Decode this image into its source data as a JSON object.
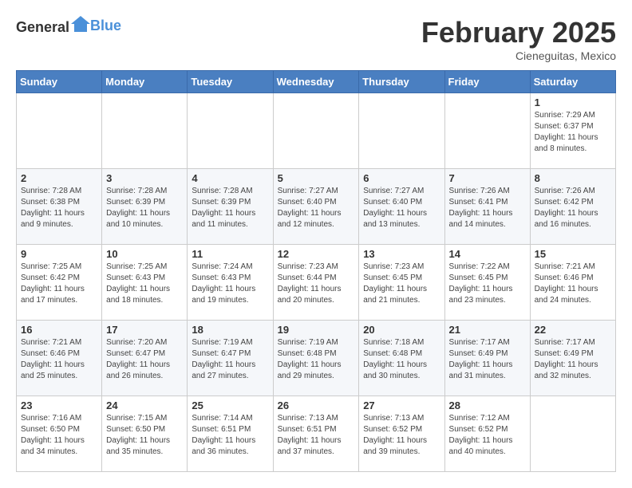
{
  "header": {
    "logo_general": "General",
    "logo_blue": "Blue",
    "title": "February 2025",
    "subtitle": "Cieneguitas, Mexico"
  },
  "days_of_week": [
    "Sunday",
    "Monday",
    "Tuesday",
    "Wednesday",
    "Thursday",
    "Friday",
    "Saturday"
  ],
  "weeks": [
    [
      {
        "day": "",
        "info": ""
      },
      {
        "day": "",
        "info": ""
      },
      {
        "day": "",
        "info": ""
      },
      {
        "day": "",
        "info": ""
      },
      {
        "day": "",
        "info": ""
      },
      {
        "day": "",
        "info": ""
      },
      {
        "day": "1",
        "info": "Sunrise: 7:29 AM\nSunset: 6:37 PM\nDaylight: 11 hours and 8 minutes."
      }
    ],
    [
      {
        "day": "2",
        "info": "Sunrise: 7:28 AM\nSunset: 6:38 PM\nDaylight: 11 hours and 9 minutes."
      },
      {
        "day": "3",
        "info": "Sunrise: 7:28 AM\nSunset: 6:39 PM\nDaylight: 11 hours and 10 minutes."
      },
      {
        "day": "4",
        "info": "Sunrise: 7:28 AM\nSunset: 6:39 PM\nDaylight: 11 hours and 11 minutes."
      },
      {
        "day": "5",
        "info": "Sunrise: 7:27 AM\nSunset: 6:40 PM\nDaylight: 11 hours and 12 minutes."
      },
      {
        "day": "6",
        "info": "Sunrise: 7:27 AM\nSunset: 6:40 PM\nDaylight: 11 hours and 13 minutes."
      },
      {
        "day": "7",
        "info": "Sunrise: 7:26 AM\nSunset: 6:41 PM\nDaylight: 11 hours and 14 minutes."
      },
      {
        "day": "8",
        "info": "Sunrise: 7:26 AM\nSunset: 6:42 PM\nDaylight: 11 hours and 16 minutes."
      }
    ],
    [
      {
        "day": "9",
        "info": "Sunrise: 7:25 AM\nSunset: 6:42 PM\nDaylight: 11 hours and 17 minutes."
      },
      {
        "day": "10",
        "info": "Sunrise: 7:25 AM\nSunset: 6:43 PM\nDaylight: 11 hours and 18 minutes."
      },
      {
        "day": "11",
        "info": "Sunrise: 7:24 AM\nSunset: 6:43 PM\nDaylight: 11 hours and 19 minutes."
      },
      {
        "day": "12",
        "info": "Sunrise: 7:23 AM\nSunset: 6:44 PM\nDaylight: 11 hours and 20 minutes."
      },
      {
        "day": "13",
        "info": "Sunrise: 7:23 AM\nSunset: 6:45 PM\nDaylight: 11 hours and 21 minutes."
      },
      {
        "day": "14",
        "info": "Sunrise: 7:22 AM\nSunset: 6:45 PM\nDaylight: 11 hours and 23 minutes."
      },
      {
        "day": "15",
        "info": "Sunrise: 7:21 AM\nSunset: 6:46 PM\nDaylight: 11 hours and 24 minutes."
      }
    ],
    [
      {
        "day": "16",
        "info": "Sunrise: 7:21 AM\nSunset: 6:46 PM\nDaylight: 11 hours and 25 minutes."
      },
      {
        "day": "17",
        "info": "Sunrise: 7:20 AM\nSunset: 6:47 PM\nDaylight: 11 hours and 26 minutes."
      },
      {
        "day": "18",
        "info": "Sunrise: 7:19 AM\nSunset: 6:47 PM\nDaylight: 11 hours and 27 minutes."
      },
      {
        "day": "19",
        "info": "Sunrise: 7:19 AM\nSunset: 6:48 PM\nDaylight: 11 hours and 29 minutes."
      },
      {
        "day": "20",
        "info": "Sunrise: 7:18 AM\nSunset: 6:48 PM\nDaylight: 11 hours and 30 minutes."
      },
      {
        "day": "21",
        "info": "Sunrise: 7:17 AM\nSunset: 6:49 PM\nDaylight: 11 hours and 31 minutes."
      },
      {
        "day": "22",
        "info": "Sunrise: 7:17 AM\nSunset: 6:49 PM\nDaylight: 11 hours and 32 minutes."
      }
    ],
    [
      {
        "day": "23",
        "info": "Sunrise: 7:16 AM\nSunset: 6:50 PM\nDaylight: 11 hours and 34 minutes."
      },
      {
        "day": "24",
        "info": "Sunrise: 7:15 AM\nSunset: 6:50 PM\nDaylight: 11 hours and 35 minutes."
      },
      {
        "day": "25",
        "info": "Sunrise: 7:14 AM\nSunset: 6:51 PM\nDaylight: 11 hours and 36 minutes."
      },
      {
        "day": "26",
        "info": "Sunrise: 7:13 AM\nSunset: 6:51 PM\nDaylight: 11 hours and 37 minutes."
      },
      {
        "day": "27",
        "info": "Sunrise: 7:13 AM\nSunset: 6:52 PM\nDaylight: 11 hours and 39 minutes."
      },
      {
        "day": "28",
        "info": "Sunrise: 7:12 AM\nSunset: 6:52 PM\nDaylight: 11 hours and 40 minutes."
      },
      {
        "day": "",
        "info": ""
      }
    ]
  ]
}
